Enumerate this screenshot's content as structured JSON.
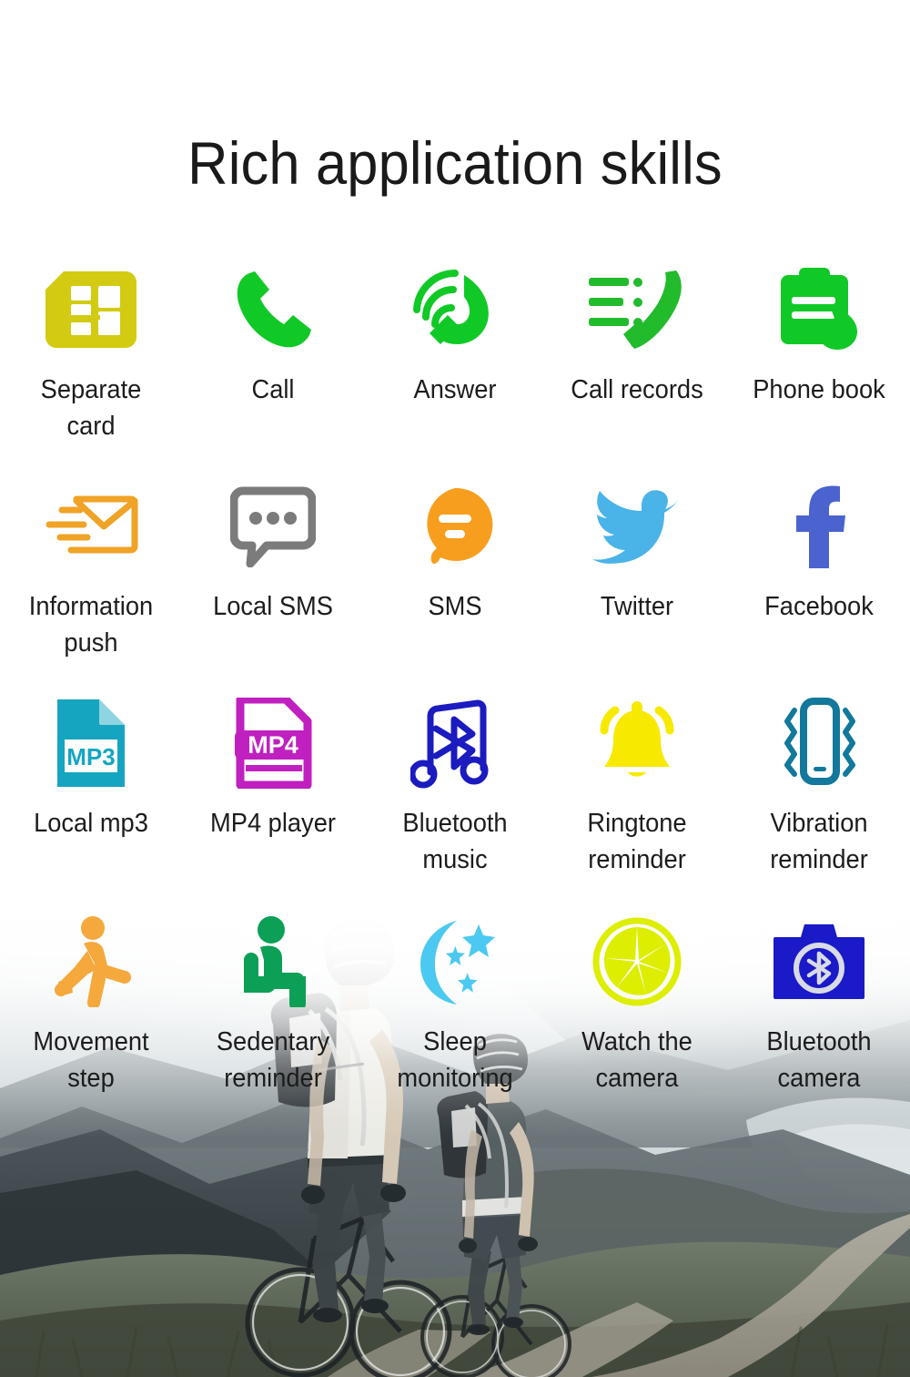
{
  "page": {
    "title": "Rich application skills",
    "title_color": "#1a1a1a",
    "label_color": "#1c1c1c",
    "background_color": "#ffffff"
  },
  "background_image": {
    "name": "cyclists-mountain-ridge-photo",
    "description": "Two cyclists on a dirt trail on a mountain ridge overlooking a coastline and bay",
    "palette": [
      "#b9c0c2",
      "#8d969a",
      "#5d686c",
      "#3e484c",
      "#2b3336",
      "#e8edee"
    ]
  },
  "grid": {
    "columns": 5,
    "rows": [
      {
        "cells": [
          {
            "label": "Separate\ncard",
            "icon": "sim-card-icon",
            "color": "#d2cb12"
          },
          {
            "label": "Call",
            "icon": "phone-handset-icon",
            "color": "#10c926"
          },
          {
            "label": "Answer",
            "icon": "incoming-call-icon",
            "color": "#10c926"
          },
          {
            "label": "Call records",
            "icon": "call-records-icon",
            "color": "#21bb2c"
          },
          {
            "label": "Phone book",
            "icon": "phone-book-icon",
            "color": "#10c926"
          }
        ]
      },
      {
        "cells": [
          {
            "label": "Information\npush",
            "icon": "envelope-push-icon",
            "color": "#f0a326"
          },
          {
            "label": "Local SMS",
            "icon": "speech-bubble-icon",
            "color": "#7b7b7b"
          },
          {
            "label": "SMS",
            "icon": "sms-bubble-icon",
            "color": "#f79e1f"
          },
          {
            "label": "Twitter",
            "icon": "twitter-bird-icon",
            "color": "#4ab3e8"
          },
          {
            "label": "Facebook",
            "icon": "facebook-f-icon",
            "color": "#4a63cf"
          }
        ]
      },
      {
        "cells": [
          {
            "label": "Local mp3",
            "icon": "mp3-file-icon",
            "color": "#15a5c0",
            "badge": "MP3"
          },
          {
            "label": "MP4 player",
            "icon": "mp4-file-icon",
            "color": "#c020c0",
            "badge": "MP4"
          },
          {
            "label": "Bluetooth\nmusic",
            "icon": "bluetooth-music-icon",
            "color": "#1b1bc0"
          },
          {
            "label": "Ringtone\nreminder",
            "icon": "bell-icon",
            "color": "#f7e900"
          },
          {
            "label": "Vibration\nreminder",
            "icon": "vibration-phone-icon",
            "color": "#12789c"
          }
        ]
      },
      {
        "cells": [
          {
            "label": "Movement\nstep",
            "icon": "running-person-icon",
            "color": "#f5a83c"
          },
          {
            "label": "Sedentary\nreminder",
            "icon": "sitting-person-icon",
            "color": "#0ba055"
          },
          {
            "label": "Sleep\nmonitoring",
            "icon": "moon-stars-icon",
            "color": "#4cc9f0"
          },
          {
            "label": "Watch the\ncamera",
            "icon": "camera-aperture-icon",
            "color": "#ddee00"
          },
          {
            "label": "Bluetooth\ncamera",
            "icon": "bluetooth-camera-icon",
            "color": "#1a1ac8"
          }
        ]
      }
    ]
  }
}
